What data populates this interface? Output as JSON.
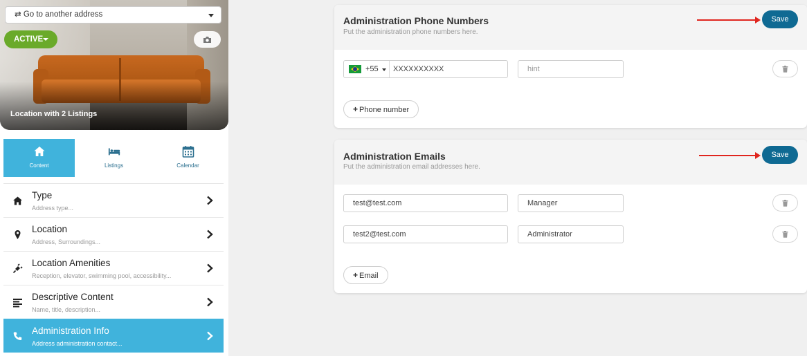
{
  "sidebar": {
    "address_select": "⇄ Go to another address",
    "status_button": "ACTIVE",
    "hero_caption": "Location with 2 Listings",
    "tabs": [
      {
        "label": "Content",
        "icon": "home-icon",
        "active": true
      },
      {
        "label": "Listings",
        "icon": "bed-icon",
        "active": false
      },
      {
        "label": "Calendar",
        "icon": "calendar-icon",
        "active": false
      }
    ],
    "menu": [
      {
        "title": "Type",
        "subtitle": "Address type...",
        "icon": "home-icon"
      },
      {
        "title": "Location",
        "subtitle": "Address, Surroundings...",
        "icon": "map-pin-icon"
      },
      {
        "title": "Location Amenities",
        "subtitle": "Reception, elevator, swimming pool, accessibility...",
        "icon": "plug-icon"
      },
      {
        "title": "Descriptive Content",
        "subtitle": "Name, title, description...",
        "icon": "align-left-icon"
      },
      {
        "title": "Administration Info",
        "subtitle": "Address administration contact...",
        "icon": "phone-icon",
        "active": true
      }
    ]
  },
  "phones_card": {
    "title": "Administration Phone Numbers",
    "subtitle": "Put the administration phone numbers here.",
    "save_label": "Save",
    "rows": [
      {
        "country_code": "+55",
        "number": "XXXXXXXXXX",
        "hint_placeholder": "hint"
      }
    ],
    "add_label": "Phone number"
  },
  "emails_card": {
    "title": "Administration Emails",
    "subtitle": "Put the administration email addresses here.",
    "save_label": "Save",
    "rows": [
      {
        "email": "test@test.com",
        "role": "Manager"
      },
      {
        "email": "test2@test.com",
        "role": "Administrator"
      }
    ],
    "add_label": "Email"
  },
  "colors": {
    "accent": "#40b3dc",
    "save_button": "#0f6a93",
    "active_status": "#6aaa2a",
    "annotation_arrow": "#e0251e"
  }
}
